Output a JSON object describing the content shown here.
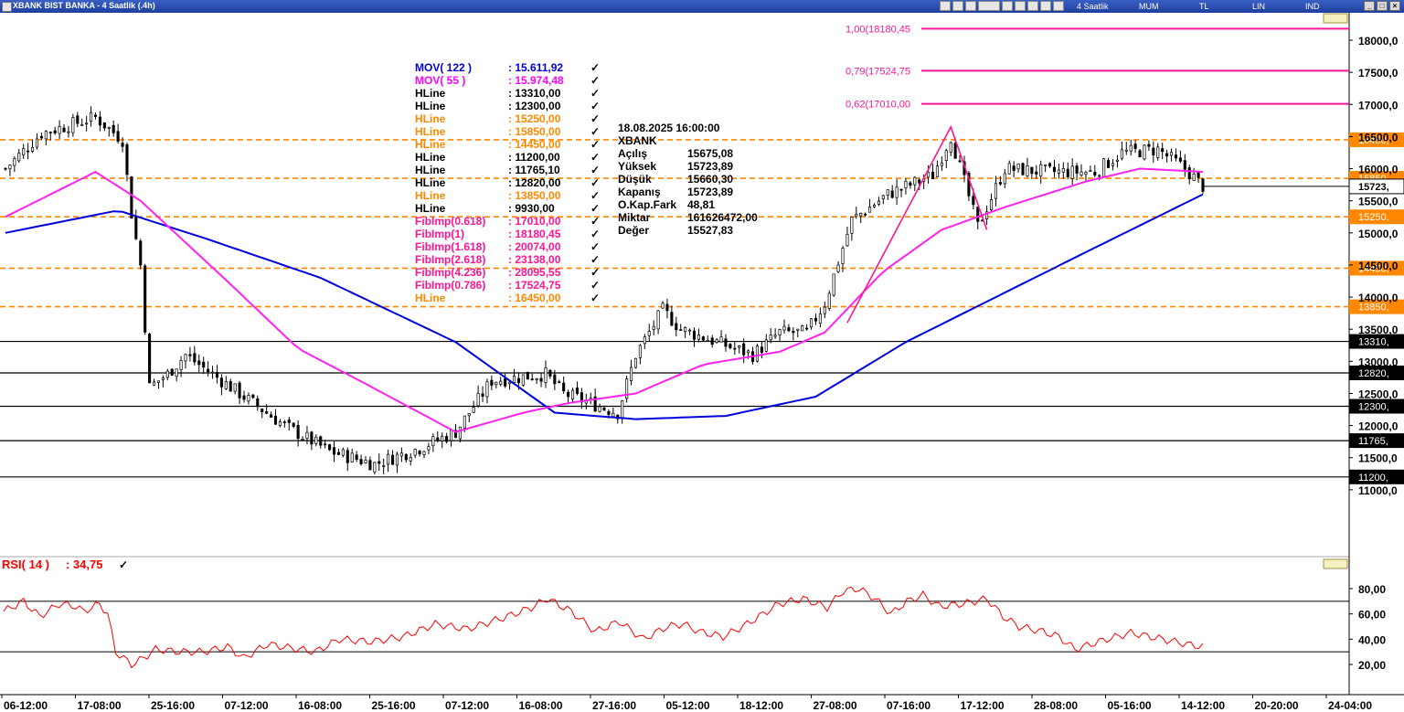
{
  "window": {
    "title": "XBANK BIST BANKA - 4 Saatlik (.4h)",
    "toolbar_labels": [
      "4 Saatlik",
      "MUM",
      "TL",
      "LIN",
      "IND"
    ]
  },
  "colors": {
    "candle_up": "#ffffff",
    "candle_down": "#000000",
    "mov122": "#0000dd",
    "mov55": "#ff22ee",
    "hline_black": "#000000",
    "hline_orange": "#ff8800",
    "fib": "#ff1493",
    "rsi": "#ff0000"
  },
  "legend": [
    {
      "label": "MOV( 122 )",
      "value": ": 15.611,92",
      "color": "#0000dd"
    },
    {
      "label": "MOV( 55 )",
      "value": ": 15.974,48",
      "color": "#ff00ff"
    },
    {
      "label": "HLine",
      "value": ": 13310,00",
      "color": "#000000"
    },
    {
      "label": "HLine",
      "value": ": 12300,00",
      "color": "#000000"
    },
    {
      "label": "HLine",
      "value": ": 15250,00",
      "color": "#ff8800"
    },
    {
      "label": "HLine",
      "value": ": 15850,00",
      "color": "#ff8800"
    },
    {
      "label": "HLine",
      "value": ": 14450,00",
      "color": "#ff8800"
    },
    {
      "label": "HLine",
      "value": ": 11200,00",
      "color": "#000000"
    },
    {
      "label": "HLine",
      "value": ": 11765,10",
      "color": "#000000"
    },
    {
      "label": "HLine",
      "value": ": 12820,00",
      "color": "#000000"
    },
    {
      "label": "HLine",
      "value": ": 13850,00",
      "color": "#ff8800"
    },
    {
      "label": "HLine",
      "value": ": 9930,00",
      "color": "#000000"
    },
    {
      "label": "FibImp(0.618)",
      "value": ": 17010,00",
      "color": "#ff1493"
    },
    {
      "label": "FibImp(1)",
      "value": ": 18180,45",
      "color": "#ff1493"
    },
    {
      "label": "FibImp(1.618)",
      "value": ": 20074,00",
      "color": "#ff1493"
    },
    {
      "label": "FibImp(2.618)",
      "value": ": 23138,00",
      "color": "#ff1493"
    },
    {
      "label": "FibImp(4.236)",
      "value": ": 28095,55",
      "color": "#ff1493"
    },
    {
      "label": "FibImp(0.786)",
      "value": ": 17524,75",
      "color": "#ff1493"
    },
    {
      "label": "HLine",
      "value": ": 16450,00",
      "color": "#ff8800"
    }
  ],
  "info": {
    "datetime": "18.08.2025  16:00:00",
    "symbol": "XBANK",
    "rows": [
      {
        "label": "Açılış",
        "value": "15675,08"
      },
      {
        "label": "Yüksek",
        "value": "15723,89"
      },
      {
        "label": "Düşük",
        "value": "15660,30"
      },
      {
        "label": "Kapanış",
        "value": "15723,89"
      },
      {
        "label": "O.Kap.Fark",
        "value": "48,81"
      },
      {
        "label": "Miktar",
        "value": "161626472,00"
      },
      {
        "label": "Değer",
        "value": "15527,83"
      }
    ]
  },
  "chart_data": [
    {
      "type": "candlestick",
      "title": "XBANK BIST BANKA - 4 Saatlik (.4h)",
      "y_scale": {
        "ref_value": 15500,
        "ref_price_at": 15500
      },
      "ylim": [
        10000,
        18200
      ],
      "yticks": [
        11000,
        11500,
        12000,
        12500,
        13000,
        13500,
        14000,
        14500,
        15000,
        15500,
        16000,
        16500,
        17000,
        17500,
        18000
      ],
      "ytick_labels": [
        "11000,0",
        "11500,0",
        "12000,0",
        "12500,0",
        "13000,0",
        "13500,0",
        "14000,0",
        "14500,0",
        "15000,0",
        "15500,0",
        "16000,0",
        "16500,0",
        "17000,0",
        "17500,0",
        "18000,0"
      ],
      "xtick_labels": [
        "06-12:00",
        "17-08:00",
        "25-16:00",
        "07-12:00",
        "16-08:00",
        "25-16:00",
        "07-12:00",
        "16-08:00",
        "27-16:00",
        "05-12:00",
        "18-12:00",
        "27-08:00",
        "07-16:00",
        "17-12:00",
        "28-08:00",
        "05-16:00",
        "14-12:00",
        "20-20:00",
        "24-04:00"
      ],
      "close_anchors": [
        [
          0,
          16000
        ],
        [
          8,
          16550
        ],
        [
          20,
          16800
        ],
        [
          26,
          16450
        ],
        [
          28,
          15300
        ],
        [
          30,
          14500
        ],
        [
          32,
          12600
        ],
        [
          36,
          12800
        ],
        [
          40,
          13100
        ],
        [
          50,
          12600
        ],
        [
          62,
          12000
        ],
        [
          72,
          11600
        ],
        [
          82,
          11400
        ],
        [
          92,
          11650
        ],
        [
          100,
          11900
        ],
        [
          108,
          12700
        ],
        [
          120,
          12800
        ],
        [
          124,
          12500
        ],
        [
          132,
          12300
        ],
        [
          136,
          12200
        ],
        [
          140,
          13100
        ],
        [
          146,
          13800
        ],
        [
          150,
          13500
        ],
        [
          158,
          13300
        ],
        [
          166,
          13100
        ],
        [
          172,
          13450
        ],
        [
          178,
          13450
        ],
        [
          182,
          13900
        ],
        [
          188,
          15200
        ],
        [
          196,
          15600
        ],
        [
          206,
          15900
        ],
        [
          210,
          16500
        ],
        [
          216,
          15100
        ],
        [
          222,
          16000
        ],
        [
          232,
          15950
        ],
        [
          242,
          15950
        ],
        [
          248,
          16250
        ],
        [
          256,
          16300
        ],
        [
          262,
          16000
        ],
        [
          266,
          15730
        ]
      ],
      "candle_count": 267,
      "overlays": [
        {
          "name": "MOV( 122 )",
          "color": "#0000dd",
          "points": [
            [
              0,
              15000
            ],
            [
              25,
              15350
            ],
            [
              45,
              14900
            ],
            [
              70,
              14300
            ],
            [
              100,
              13300
            ],
            [
              122,
              12200
            ],
            [
              140,
              12100
            ],
            [
              160,
              12150
            ],
            [
              180,
              12450
            ],
            [
              200,
              13300
            ],
            [
              220,
              14000
            ],
            [
              240,
              14700
            ],
            [
              266,
              15600
            ]
          ]
        },
        {
          "name": "MOV( 55 )",
          "color": "#ff22ee",
          "points": [
            [
              0,
              15250
            ],
            [
              20,
              15950
            ],
            [
              30,
              15500
            ],
            [
              50,
              14200
            ],
            [
              65,
              13200
            ],
            [
              80,
              12650
            ],
            [
              100,
              11900
            ],
            [
              115,
              12200
            ],
            [
              125,
              12350
            ],
            [
              140,
              12500
            ],
            [
              155,
              12950
            ],
            [
              172,
              13150
            ],
            [
              182,
              13450
            ],
            [
              195,
              14400
            ],
            [
              208,
              15050
            ],
            [
              222,
              15400
            ],
            [
              240,
              15800
            ],
            [
              252,
              16000
            ],
            [
              266,
              15950
            ]
          ]
        }
      ],
      "hlines": [
        {
          "value": 18180.45,
          "label": "1,00(18180,45",
          "color": "#ff1493",
          "style": "solid"
        },
        {
          "value": 17524.75,
          "label": "0,79(17524,75",
          "color": "#ff1493",
          "style": "solid"
        },
        {
          "value": 17010,
          "label": "0,62(17010,00",
          "color": "#ff1493",
          "style": "solid"
        },
        {
          "value": 16450,
          "label": "16450,",
          "color": "#ff8800",
          "style": "dashed"
        },
        {
          "value": 15850,
          "label": "15850,",
          "color": "#ff8800",
          "style": "dashed"
        },
        {
          "value": 15250,
          "label": "15250,",
          "color": "#ff8800",
          "style": "dashed"
        },
        {
          "value": 14450,
          "label": "14450,",
          "color": "#ff8800",
          "style": "dashed"
        },
        {
          "value": 13850,
          "label": "13850,",
          "color": "#ff8800",
          "style": "dashed"
        },
        {
          "value": 13310,
          "label": "13310,",
          "color": "#000000",
          "style": "solid"
        },
        {
          "value": 12820,
          "label": "12820,",
          "color": "#000000",
          "style": "solid"
        },
        {
          "value": 12300,
          "label": "12300,",
          "color": "#000000",
          "style": "solid"
        },
        {
          "value": 11765.1,
          "label": "11765,",
          "color": "#000000",
          "style": "solid"
        },
        {
          "value": 11200,
          "label": "11200,",
          "color": "#000000",
          "style": "solid"
        }
      ],
      "fib_zigzag": [
        [
          187,
          13600
        ],
        [
          210,
          16650
        ],
        [
          218,
          15050
        ]
      ],
      "last_price": 15723.89,
      "last_label": "15723,"
    },
    {
      "type": "line",
      "title": "RSI( 14 )",
      "current_value": ": 34,75",
      "ylim": [
        10,
        100
      ],
      "yticks": [
        20,
        40,
        60,
        80
      ],
      "ytick_labels": [
        "20,00",
        "40,00",
        "60,00",
        "80,00"
      ],
      "levels": [
        30,
        70
      ],
      "series": [
        {
          "name": "RSI( 14 )",
          "color": "#ff0000",
          "points": [
            [
              0,
              62
            ],
            [
              5,
              70
            ],
            [
              9,
              58
            ],
            [
              14,
              68
            ],
            [
              18,
              66
            ],
            [
              20,
              62
            ],
            [
              24,
              68
            ],
            [
              26,
              60
            ],
            [
              28,
              30
            ],
            [
              32,
              20
            ],
            [
              35,
              25
            ],
            [
              38,
              32
            ],
            [
              44,
              30
            ],
            [
              50,
              30
            ],
            [
              56,
              34
            ],
            [
              60,
              25
            ],
            [
              66,
              36
            ],
            [
              72,
              33
            ],
            [
              78,
              30
            ],
            [
              84,
              40
            ],
            [
              92,
              38
            ],
            [
              100,
              42
            ],
            [
              108,
              52
            ],
            [
              116,
              48
            ],
            [
              126,
              58
            ],
            [
              132,
              65
            ],
            [
              136,
              72
            ],
            [
              142,
              62
            ],
            [
              148,
              46
            ],
            [
              154,
              54
            ],
            [
              160,
              40
            ],
            [
              166,
              50
            ],
            [
              170,
              52
            ],
            [
              174,
              46
            ],
            [
              180,
              42
            ],
            [
              186,
              52
            ],
            [
              194,
              68
            ],
            [
              200,
              72
            ],
            [
              206,
              65
            ],
            [
              210,
              78
            ],
            [
              214,
              80
            ],
            [
              218,
              72
            ],
            [
              222,
              60
            ],
            [
              226,
              70
            ],
            [
              230,
              75
            ],
            [
              234,
              66
            ],
            [
              240,
              68
            ],
            [
              246,
              72
            ],
            [
              250,
              58
            ],
            [
              254,
              50
            ],
            [
              260,
              46
            ],
            [
              264,
              42
            ],
            [
              268,
              32
            ],
            [
              276,
              40
            ],
            [
              282,
              45
            ],
            [
              290,
              40
            ],
            [
              296,
              36
            ],
            [
              300,
              34
            ]
          ]
        }
      ]
    }
  ]
}
